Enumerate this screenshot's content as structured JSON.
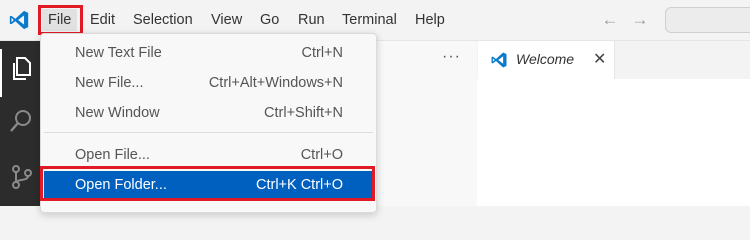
{
  "menubar": {
    "items": [
      {
        "label": "File"
      },
      {
        "label": "Edit"
      },
      {
        "label": "Selection"
      },
      {
        "label": "View"
      },
      {
        "label": "Go"
      },
      {
        "label": "Run"
      },
      {
        "label": "Terminal"
      },
      {
        "label": "Help"
      }
    ],
    "nav_back": "←",
    "nav_forward": "→"
  },
  "file_menu": {
    "groups": [
      [
        {
          "label": "New Text File",
          "shortcut": "Ctrl+N"
        },
        {
          "label": "New File...",
          "shortcut": "Ctrl+Alt+Windows+N"
        },
        {
          "label": "New Window",
          "shortcut": "Ctrl+Shift+N"
        }
      ],
      [
        {
          "label": "Open File...",
          "shortcut": "Ctrl+O"
        },
        {
          "label": "Open Folder...",
          "shortcut": "Ctrl+K Ctrl+O"
        }
      ]
    ]
  },
  "sidebar": {
    "more_actions": "···"
  },
  "editor": {
    "tabs": [
      {
        "label": "Welcome",
        "close": "✕"
      }
    ]
  },
  "colors": {
    "accent": "#0060c0",
    "highlight": "#e01b24",
    "activitybar": "#2c2c2c",
    "vscode_blue": "#0a7acc"
  },
  "icons": [
    "vscode-logo-icon",
    "explorer-icon",
    "search-icon",
    "source-control-icon",
    "close-icon"
  ]
}
